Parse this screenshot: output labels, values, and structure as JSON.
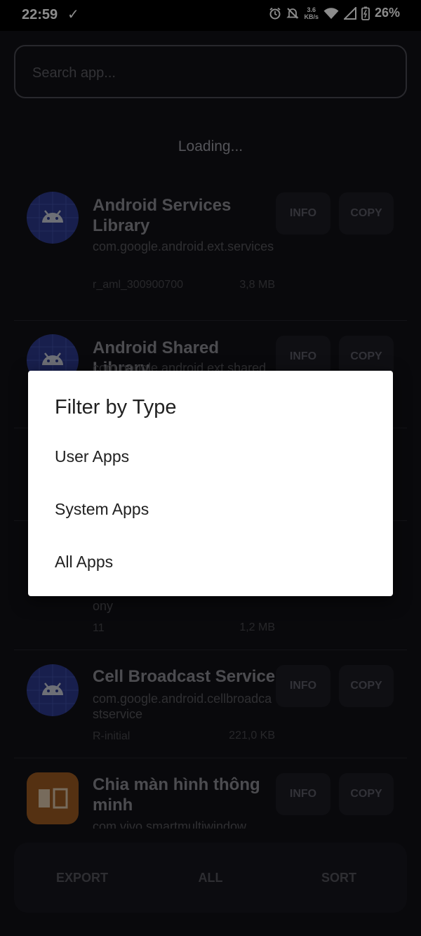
{
  "status_bar": {
    "time": "22:59",
    "speed_value": "3.6",
    "speed_unit": "KB/s",
    "battery": "26%"
  },
  "search": {
    "placeholder": "Search app..."
  },
  "loading_text": "Loading...",
  "buttons": {
    "info": "INFO",
    "copy": "COPY"
  },
  "apps": [
    {
      "name": "Android Services Library",
      "package": "com.google.android.ext.services",
      "version": "r_aml_300900700",
      "size": "3,8 MB",
      "icon": "android-robot-icon"
    },
    {
      "name": "Android Shared Library",
      "package": "com.google.android.ext.shared",
      "version": "",
      "size": "",
      "icon": "android-robot-icon"
    },
    {
      "name": "",
      "package": "ony",
      "version": "11",
      "size": "1,2 MB",
      "icon": ""
    },
    {
      "name": "Cell Broadcast Service",
      "package": "com.google.android.cellbroadcastservice",
      "version": "R-initial",
      "size": "221,0 KB",
      "icon": "android-robot-icon"
    },
    {
      "name": "Chia màn hình thông minh",
      "package": "com.vivo.smartmultiwindow",
      "version": "",
      "size": "",
      "icon": "split-screen-icon"
    }
  ],
  "bottom_bar": {
    "export": "EXPORT",
    "all": "ALL",
    "sort": "SORT"
  },
  "dialog": {
    "title": "Filter by Type",
    "options": [
      "User Apps",
      "System Apps",
      "All Apps"
    ]
  },
  "colors": {
    "background": "#121216",
    "dialog_background": "#ffffff",
    "android_icon_blue": "#2d3a8c",
    "split_icon_orange": "#9c5a22"
  }
}
